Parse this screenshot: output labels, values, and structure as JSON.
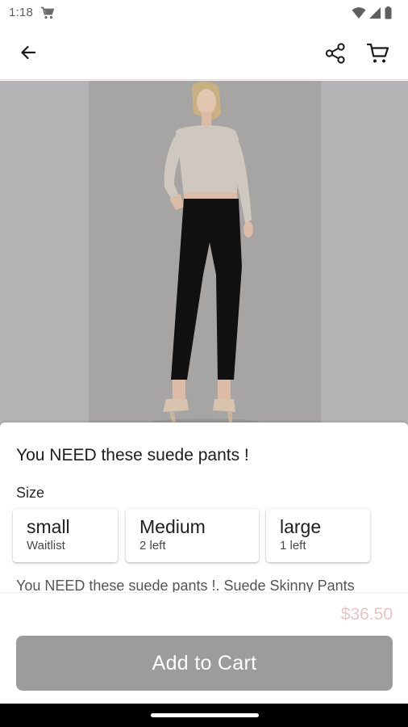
{
  "status_bar": {
    "time": "1:18",
    "icons": [
      "shopping-cart-icon",
      "wifi-icon",
      "signal-icon",
      "battery-icon"
    ]
  },
  "app_bar": {
    "icons": [
      "arrow-back-icon",
      "share-icon",
      "cart-icon"
    ]
  },
  "product": {
    "title": "You NEED these suede pants !",
    "size_label": "Size",
    "sizes": [
      {
        "name": "small",
        "stock": "Waitlist"
      },
      {
        "name": "Medium",
        "stock": "2 left"
      },
      {
        "name": "large",
        "stock": "1 left"
      }
    ],
    "description": "You NEED these suede pants !. Suede Skinny Pants",
    "price": "$36.50",
    "add_to_cart_label": "Add to Cart"
  },
  "colors": {
    "image_backdrop": "#b4b4b6",
    "photo_background": "#a6a5a3",
    "price": "#e8c5c5",
    "button": "#9c9c9c",
    "button_text": "#ffffff",
    "top_color": "#cfc8c0",
    "pants_color": "#111111"
  }
}
